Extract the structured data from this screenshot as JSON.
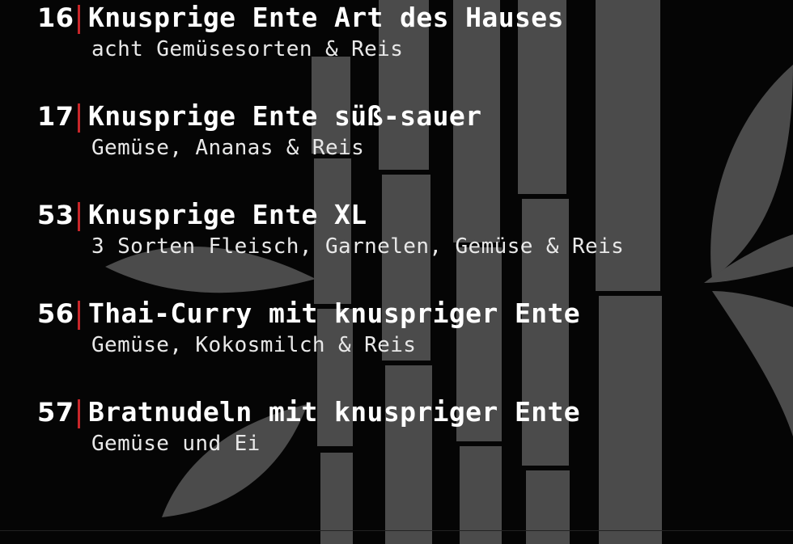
{
  "menu": {
    "items": [
      {
        "number": "16",
        "title": "Knusprige Ente Art des Hauses",
        "description": "acht Gemüsesorten & Reis"
      },
      {
        "number": "17",
        "title": "Knusprige Ente süß-sauer",
        "description": "Gemüse, Ananas & Reis"
      },
      {
        "number": "53",
        "title": "Knusprige Ente XL",
        "description": "3 Sorten Fleisch, Garnelen, Gemüse & Reis"
      },
      {
        "number": "56",
        "title": "Thai-Curry mit knuspriger Ente",
        "description": "Gemüse, Kokosmilch & Reis"
      },
      {
        "number": "57",
        "title": "Bratnudeln mit knuspriger Ente",
        "description": "Gemüse und Ei"
      }
    ]
  },
  "colors": {
    "background": "#050505",
    "accent_bar": "#c8262a",
    "bamboo": "#4a4a4a",
    "text": "#ffffff"
  }
}
